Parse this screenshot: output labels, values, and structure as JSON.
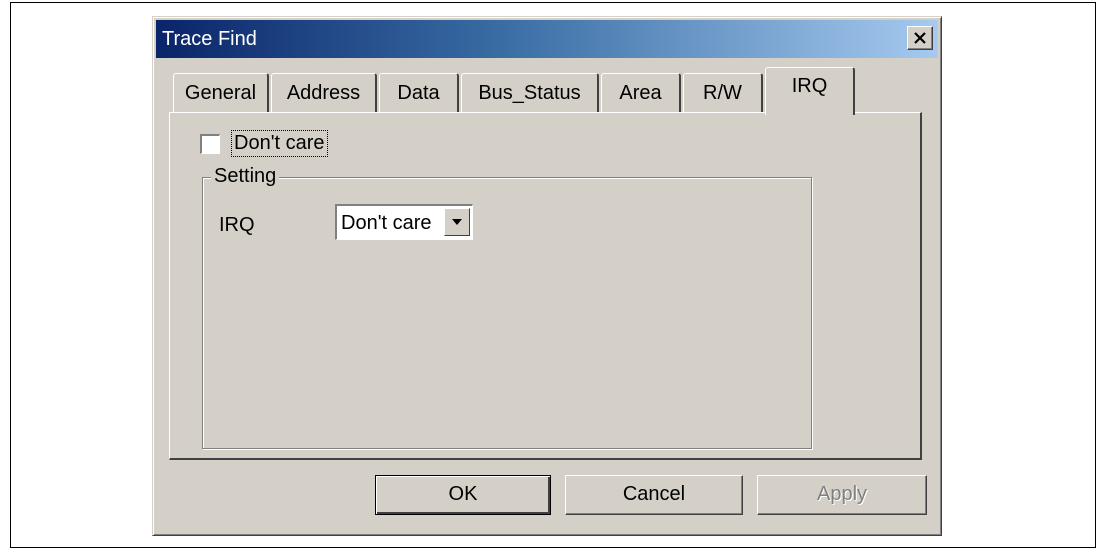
{
  "window": {
    "title": "Trace Find",
    "close_symbol": "×"
  },
  "tabs": [
    {
      "label": "General"
    },
    {
      "label": "Address"
    },
    {
      "label": "Data"
    },
    {
      "label": "Bus_Status"
    },
    {
      "label": "Area"
    },
    {
      "label": "R/W"
    },
    {
      "label": "IRQ",
      "selected": true
    }
  ],
  "panel": {
    "dont_care_checkbox": {
      "label": "Don't care",
      "checked": false
    },
    "setting_group": {
      "title": "Setting",
      "irq_label": "IRQ",
      "irq_select_value": "Don't care"
    }
  },
  "buttons": {
    "ok": "OK",
    "cancel": "Cancel",
    "apply": "Apply"
  },
  "colors": {
    "titlebar_start": "#0a246a",
    "titlebar_end": "#a6caf0",
    "face": "#d4d0c8"
  },
  "icons": {
    "close": "close-icon",
    "dropdown": "chevron-down-icon"
  }
}
